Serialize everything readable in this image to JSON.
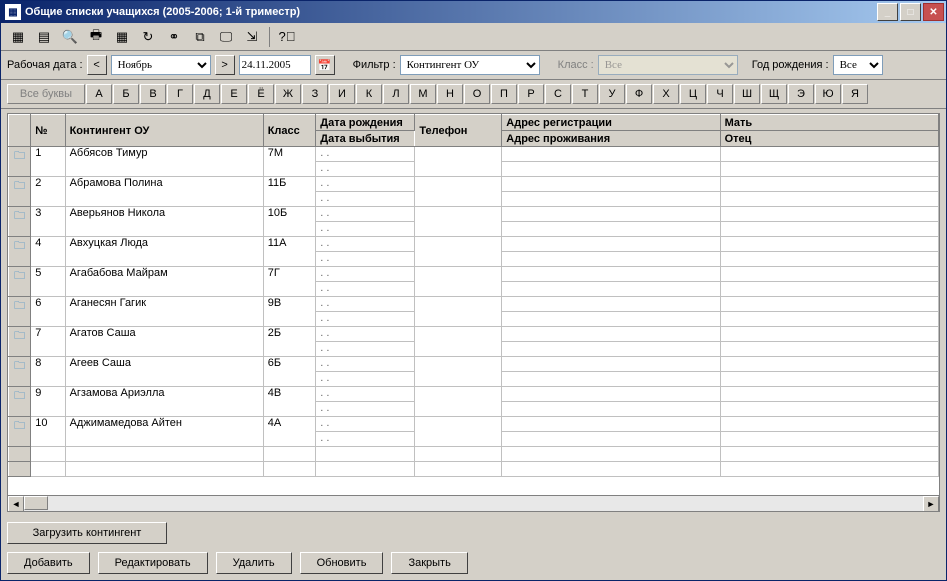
{
  "window": {
    "title": "Общие списки учащихся  (2005-2006; 1-й триместр)"
  },
  "toolbar_icons": [
    {
      "name": "grid-icon",
      "glyph": "▦"
    },
    {
      "name": "report-icon",
      "glyph": "▤"
    },
    {
      "name": "find-icon",
      "glyph": "🔍"
    },
    {
      "name": "print-icon",
      "glyph": "🖶"
    },
    {
      "name": "table-icon",
      "glyph": "▦"
    },
    {
      "name": "refresh-icon",
      "glyph": "↻"
    },
    {
      "name": "link-icon",
      "glyph": "⚭"
    },
    {
      "name": "copy-icon",
      "glyph": "⧉"
    },
    {
      "name": "monitor-icon",
      "glyph": "🖵"
    },
    {
      "name": "export-icon",
      "glyph": "⇲"
    },
    {
      "name": "help-icon",
      "glyph": "?⃝"
    }
  ],
  "filter": {
    "workdate_label": "Рабочая дата :",
    "prev": "<",
    "month": "Ноябрь",
    "next": ">",
    "date": "24.11.2005",
    "filter_label": "Фильтр :",
    "filter_value": "Контингент ОУ",
    "class_label": "Класс :",
    "class_value": "Все",
    "year_label": "Год рождения :",
    "year_value": "Все"
  },
  "letters": {
    "all": "Все буквы",
    "items": [
      "А",
      "Б",
      "В",
      "Г",
      "Д",
      "Е",
      "Ё",
      "Ж",
      "З",
      "И",
      "К",
      "Л",
      "М",
      "Н",
      "О",
      "П",
      "Р",
      "С",
      "Т",
      "У",
      "Ф",
      "Х",
      "Ц",
      "Ч",
      "Ш",
      "Щ",
      "Э",
      "Ю",
      "Я"
    ]
  },
  "columns": {
    "num": "№",
    "contingent": "Контингент ОУ",
    "klass": "Класс",
    "dob": "Дата рождения",
    "leave": "Дата выбытия",
    "phone": "Телефон",
    "reg_addr": "Адрес регистрации",
    "live_addr": "Адрес проживания",
    "mother": "Мать",
    "father": "Отец"
  },
  "rows": [
    {
      "n": "1",
      "name": "Аббясов Тимур",
      "klass": "7М"
    },
    {
      "n": "2",
      "name": "Абрамова Полина",
      "klass": "11Б"
    },
    {
      "n": "3",
      "name": "Аверьянов Никола",
      "klass": "10Б"
    },
    {
      "n": "4",
      "name": "Авхуцкая Люда",
      "klass": "11А"
    },
    {
      "n": "5",
      "name": "Агабабова Майрам",
      "klass": "7Г"
    },
    {
      "n": "6",
      "name": "Аганесян Гагик",
      "klass": "9В"
    },
    {
      "n": "7",
      "name": "Агатов Саша",
      "klass": "2Б"
    },
    {
      "n": "8",
      "name": "Агеев Саша",
      "klass": "6Б"
    },
    {
      "n": "9",
      "name": "Агзамова Ариэлла",
      "klass": "4В"
    },
    {
      "n": "10",
      "name": "Аджимамедова Айтен",
      "klass": "4А"
    }
  ],
  "dot": ".  .",
  "buttons": {
    "load": "Загрузить контингент",
    "add": "Добавить",
    "edit": "Редактировать",
    "delete": "Удалить",
    "refresh": "Обновить",
    "close": "Закрыть"
  }
}
